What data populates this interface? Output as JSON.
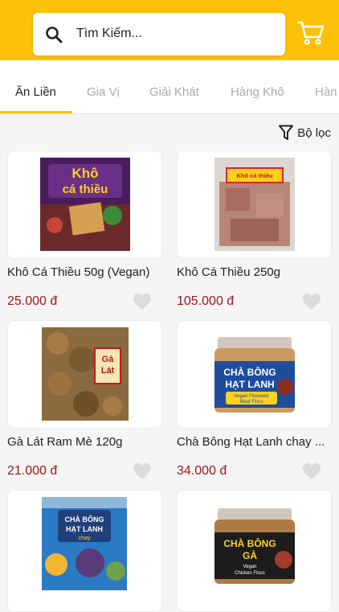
{
  "search": {
    "placeholder": "Tìm Kiếm..."
  },
  "tabs": [
    {
      "label": "Ăn Liền"
    },
    {
      "label": "Gia Vị"
    },
    {
      "label": "Giải Khát"
    },
    {
      "label": "Hàng Khô"
    },
    {
      "label": "Hàn"
    }
  ],
  "filter": {
    "label": "Bộ lọc"
  },
  "products": [
    {
      "title": "Khô Cá Thiều 50g (Vegan)",
      "price": "25.000 đ",
      "package_text": [
        "Khô",
        "cá thiều"
      ]
    },
    {
      "title": "Khô Cá Thiều 250g",
      "price": "105.000 đ",
      "package_text": [
        "Khô cá thiều"
      ]
    },
    {
      "title": "Gà Lát Ram Mè 120g",
      "price": "21.000 đ",
      "package_text": [
        "Gà",
        "Lát"
      ]
    },
    {
      "title": "Chà Bông Hạt Lanh chay ...",
      "price": "34.000 đ",
      "package_text": [
        "CHÀ BÔNG",
        "HẠT LANH",
        "Vegan Flaxseed",
        "Meat Floss"
      ]
    },
    {
      "title": "",
      "price": "",
      "package_text": [
        "CHÀ BÔNG",
        "HẠT LANH",
        "chay"
      ]
    },
    {
      "title": "",
      "price": "",
      "package_text": [
        "CHÀ BÔNG",
        "GÀ",
        "Vegan",
        "Chicken Floss"
      ]
    }
  ],
  "colors": {
    "header": "#ffc107",
    "price": "#a31717",
    "accent": "#ffc107"
  }
}
